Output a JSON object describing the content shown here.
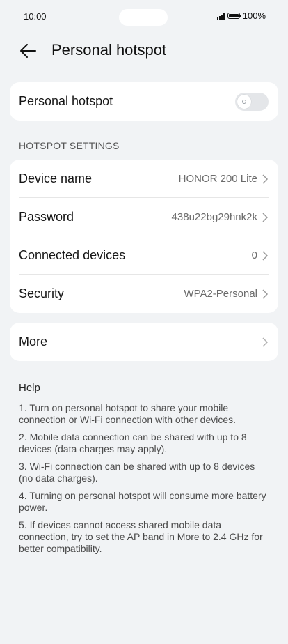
{
  "status_bar": {
    "time": "10:00",
    "battery": "100%"
  },
  "header": {
    "title": "Personal hotspot",
    "back_icon": "arrow-left-icon"
  },
  "hotspot_toggle": {
    "label": "Personal hotspot",
    "enabled": false
  },
  "settings": {
    "section_title": "HOTSPOT SETTINGS",
    "items": [
      {
        "label": "Device name",
        "value": "HONOR 200 Lite"
      },
      {
        "label": "Password",
        "value": "438u22bg29hnk2k"
      },
      {
        "label": "Connected devices",
        "value": "0"
      },
      {
        "label": "Security",
        "value": "WPA2-Personal"
      }
    ]
  },
  "more": {
    "label": "More"
  },
  "help": {
    "title": "Help",
    "items": [
      "1. Turn on personal hotspot to share your mobile connection or Wi-Fi connection with other devices.",
      "2. Mobile data connection can be shared with up to 8 devices (data charges may apply).",
      "3. Wi-Fi connection can be shared with up to 8 devices (no data charges).",
      "4. Turning on personal hotspot will consume more battery power.",
      "5. If devices cannot access shared mobile data connection, try to set the AP band in More to 2.4 GHz for better compatibility."
    ]
  },
  "colors": {
    "background": "#f1f3f5",
    "card": "#ffffff",
    "toggle_off": "#e4e6e9"
  }
}
